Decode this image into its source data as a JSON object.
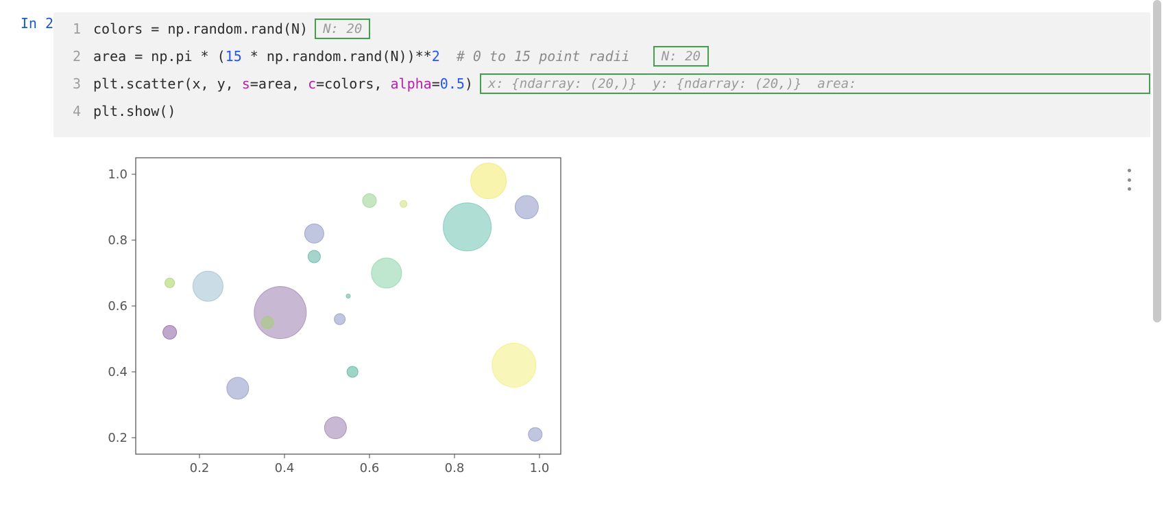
{
  "cell": {
    "prompt": "In 2",
    "lines": {
      "1": {
        "num": "1"
      },
      "2": {
        "num": "2"
      },
      "3": {
        "num": "3"
      },
      "4": {
        "num": "4"
      }
    },
    "tokens": {
      "l1_a": "colors = np.random.rand(N)",
      "l2_a": "area = np.pi * (",
      "l2_b": "15",
      "l2_c": " * np.random.rand(N))**",
      "l2_d": "2",
      "l2_e": "  # 0 to 15 point radii  ",
      "l3_a": "plt.scatter(x, y, ",
      "l3_b": "s",
      "l3_c": "=area, ",
      "l3_d": "c",
      "l3_e": "=colors, ",
      "l3_f": "alpha",
      "l3_g": "=",
      "l3_h": "0.5",
      "l3_i": ")",
      "l4_a": "plt.show()"
    },
    "hints": {
      "n1": "N: 20",
      "n2": "N: 20",
      "line3": "x: {ndarray: (20,)}  y: {ndarray: (20,)}  area:"
    }
  },
  "chart_data": {
    "type": "scatter",
    "xlabel": "",
    "ylabel": "",
    "xlim": [
      0.05,
      1.05
    ],
    "ylim": [
      0.15,
      1.05
    ],
    "xticks": [
      0.2,
      0.4,
      0.6,
      0.8,
      1.0
    ],
    "yticks": [
      0.2,
      0.4,
      0.6,
      0.8,
      1.0
    ],
    "xtick_labels": [
      "0.2",
      "0.4",
      "0.6",
      "0.8",
      "1.0"
    ],
    "ytick_labels": [
      "0.2",
      "0.4",
      "0.6",
      "0.8",
      "1.0"
    ],
    "points": [
      {
        "x": 0.88,
        "y": 0.98,
        "r": 26,
        "color": "#f2e96a"
      },
      {
        "x": 0.97,
        "y": 0.9,
        "r": 17,
        "color": "#8c95c6"
      },
      {
        "x": 0.6,
        "y": 0.92,
        "r": 10,
        "color": "#95d28e"
      },
      {
        "x": 0.68,
        "y": 0.91,
        "r": 5,
        "color": "#cfe07a"
      },
      {
        "x": 0.83,
        "y": 0.84,
        "r": 35,
        "color": "#6dc3b2"
      },
      {
        "x": 0.47,
        "y": 0.82,
        "r": 14,
        "color": "#8c95c6"
      },
      {
        "x": 0.47,
        "y": 0.75,
        "r": 9,
        "color": "#5ab2a2"
      },
      {
        "x": 0.64,
        "y": 0.7,
        "r": 22,
        "color": "#8bd3a7"
      },
      {
        "x": 0.22,
        "y": 0.66,
        "r": 22,
        "color": "#9ebfd0"
      },
      {
        "x": 0.13,
        "y": 0.67,
        "r": 7,
        "color": "#a6d35c"
      },
      {
        "x": 0.55,
        "y": 0.63,
        "r": 3,
        "color": "#5fb5a2"
      },
      {
        "x": 0.39,
        "y": 0.58,
        "r": 38,
        "color": "#9d7eb1"
      },
      {
        "x": 0.53,
        "y": 0.56,
        "r": 8,
        "color": "#8c95c6"
      },
      {
        "x": 0.36,
        "y": 0.55,
        "r": 9,
        "color": "#a1d070"
      },
      {
        "x": 0.13,
        "y": 0.52,
        "r": 10,
        "color": "#8d5ea3"
      },
      {
        "x": 0.94,
        "y": 0.42,
        "r": 32,
        "color": "#f3ef7e"
      },
      {
        "x": 0.56,
        "y": 0.4,
        "r": 8,
        "color": "#4fb297"
      },
      {
        "x": 0.29,
        "y": 0.35,
        "r": 16,
        "color": "#8c95c6"
      },
      {
        "x": 0.52,
        "y": 0.23,
        "r": 16,
        "color": "#9d7eb1"
      },
      {
        "x": 0.99,
        "y": 0.21,
        "r": 10,
        "color": "#8c95c6"
      }
    ]
  }
}
